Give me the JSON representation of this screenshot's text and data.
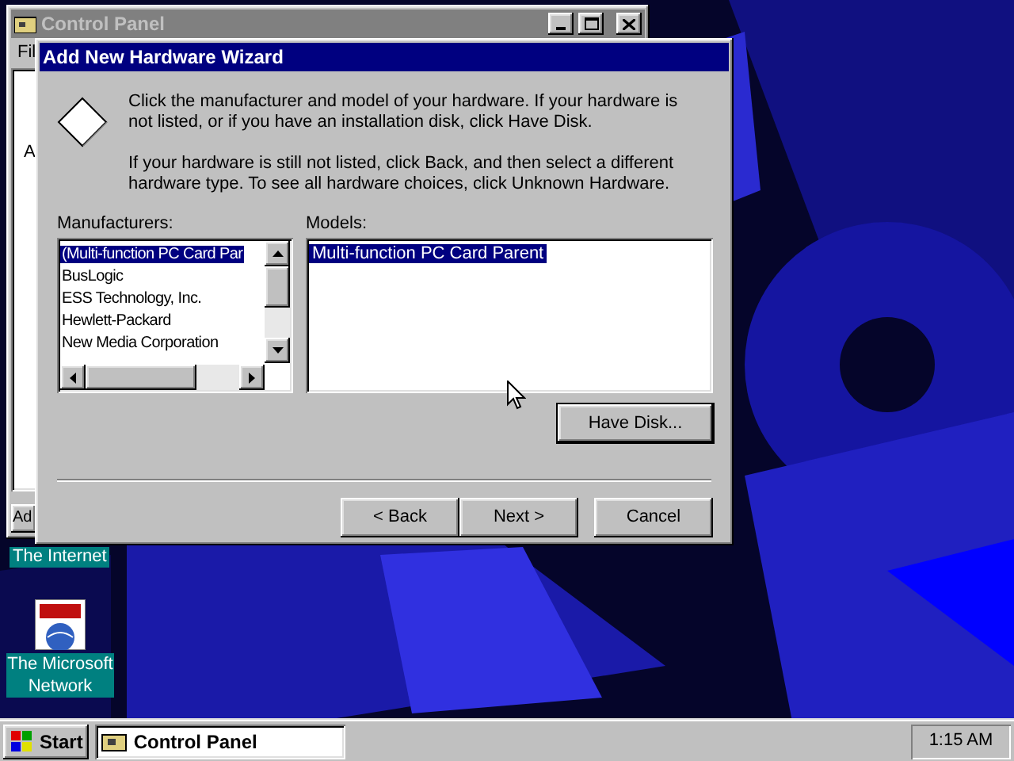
{
  "desktop": {
    "icons": [
      {
        "label": "The Internet"
      },
      {
        "label": "The Microsoft Network"
      }
    ]
  },
  "control_panel": {
    "title": "Control Panel",
    "menu": [
      "Fil"
    ],
    "content_text": "A",
    "button": "Ad"
  },
  "wizard": {
    "title": "Add New Hardware Wizard",
    "paragraphs": [
      "Click the manufacturer and model of your hardware. If your hardware is not listed, or if you have an installation disk, click Have Disk.",
      "If your hardware is still not listed, click Back, and then select a different hardware type. To see all hardware choices, click Unknown Hardware."
    ],
    "manufacturers_label": "Manufacturers:",
    "manufacturers": [
      {
        "name": "(Multi-function PC Card Par",
        "selected": true
      },
      {
        "name": "BusLogic",
        "selected": false
      },
      {
        "name": "ESS Technology, Inc.",
        "selected": false
      },
      {
        "name": "Hewlett-Packard",
        "selected": false
      },
      {
        "name": "New Media Corporation",
        "selected": false
      }
    ],
    "models_label": "Models:",
    "models": [
      {
        "name": "Multi-function PC Card Parent",
        "selected": true
      }
    ],
    "have_disk": "Have Disk...",
    "buttons": [
      "< Back",
      "Next >",
      "Cancel"
    ]
  },
  "taskbar": {
    "start": "Start",
    "tasks": [
      {
        "label": "Control Panel",
        "selected": true
      }
    ],
    "clock": "1:15 AM"
  }
}
